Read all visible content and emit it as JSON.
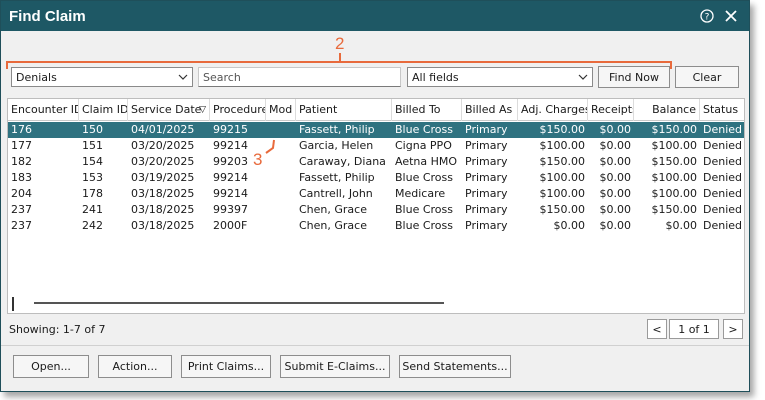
{
  "window": {
    "title": "Find Claim"
  },
  "annotations": {
    "toolbar_marker": "2",
    "row_marker": "3"
  },
  "toolbar": {
    "filter_value": "Denials",
    "search_placeholder": "Search",
    "field_value": "All fields",
    "find_now_label": "Find Now",
    "clear_label": "Clear"
  },
  "table": {
    "headers": [
      "Encounter ID",
      "Claim ID",
      "Service Date",
      "Procedure",
      "Mod",
      "Patient",
      "Billed To",
      "Billed As",
      "Adj. Charges",
      "Receipts",
      "Balance",
      "Status"
    ],
    "sort_indicator": "▽",
    "rows": [
      {
        "encounter": "176",
        "claim": "150",
        "date": "04/01/2025",
        "procedure": "99215",
        "mod": "",
        "patient": "Fassett, Philip",
        "billed_to": "Blue Cross",
        "billed_as": "Primary",
        "charges": "$150.00",
        "receipts": "$0.00",
        "balance": "$150.00",
        "status": "Denied",
        "selected": true
      },
      {
        "encounter": "177",
        "claim": "151",
        "date": "03/20/2025",
        "procedure": "99214",
        "mod": "",
        "patient": "Garcia, Helen",
        "billed_to": "Cigna PPO",
        "billed_as": "Primary",
        "charges": "$100.00",
        "receipts": "$0.00",
        "balance": "$100.00",
        "status": "Denied",
        "selected": false
      },
      {
        "encounter": "182",
        "claim": "154",
        "date": "03/20/2025",
        "procedure": "99203",
        "mod": "",
        "patient": "Caraway, Diana",
        "billed_to": "Aetna HMO",
        "billed_as": "Primary",
        "charges": "$150.00",
        "receipts": "$0.00",
        "balance": "$150.00",
        "status": "Denied",
        "selected": false
      },
      {
        "encounter": "183",
        "claim": "153",
        "date": "03/19/2025",
        "procedure": "99214",
        "mod": "",
        "patient": "Fassett, Philip",
        "billed_to": "Blue Cross",
        "billed_as": "Primary",
        "charges": "$100.00",
        "receipts": "$0.00",
        "balance": "$100.00",
        "status": "Denied",
        "selected": false
      },
      {
        "encounter": "204",
        "claim": "178",
        "date": "03/18/2025",
        "procedure": "99214",
        "mod": "",
        "patient": "Cantrell, John",
        "billed_to": "Medicare",
        "billed_as": "Primary",
        "charges": "$100.00",
        "receipts": "$0.00",
        "balance": "$100.00",
        "status": "Denied",
        "selected": false
      },
      {
        "encounter": "237",
        "claim": "241",
        "date": "03/18/2025",
        "procedure": "99397",
        "mod": "",
        "patient": "Chen, Grace",
        "billed_to": "Blue Cross",
        "billed_as": "Primary",
        "charges": "$150.00",
        "receipts": "$0.00",
        "balance": "$150.00",
        "status": "Denied",
        "selected": false
      },
      {
        "encounter": "237",
        "claim": "242",
        "date": "03/18/2025",
        "procedure": "2000F",
        "mod": "",
        "patient": "Chen, Grace",
        "billed_to": "Blue Cross",
        "billed_as": "Primary",
        "charges": "$0.00",
        "receipts": "$0.00",
        "balance": "$0.00",
        "status": "Denied",
        "selected": false
      }
    ]
  },
  "status": {
    "showing": "Showing: 1-7 of 7"
  },
  "pager": {
    "prev": "<",
    "page": "1 of 1",
    "next": ">"
  },
  "footer": {
    "open_label": "Open...",
    "action_label": "Action...",
    "print_label": "Print Claims...",
    "submit_label": "Submit E-Claims...",
    "statements_label": "Send Statements..."
  },
  "colors": {
    "titlebar": "#1e5865",
    "selection": "#2f7280",
    "annotation": "#e86a3c"
  },
  "icons": {
    "help": "help-circle-icon",
    "close": "close-icon",
    "dropdown": "chevron-down-icon"
  }
}
